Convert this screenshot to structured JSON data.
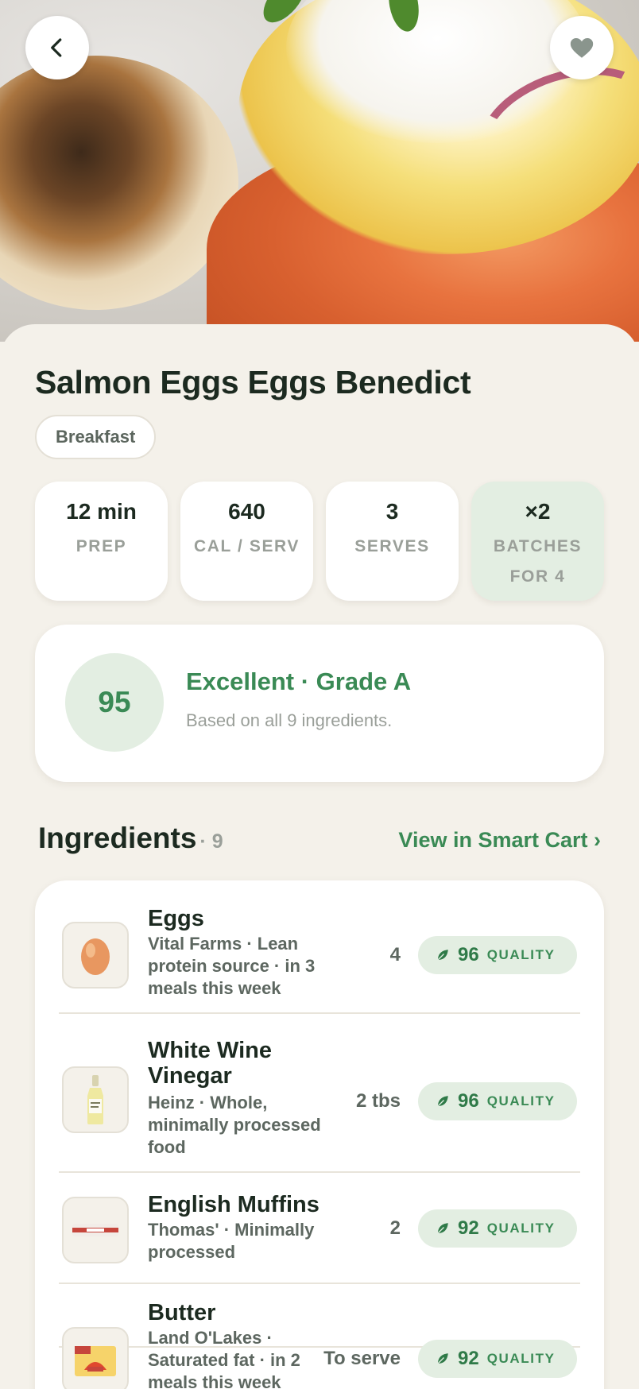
{
  "header": {
    "back_icon": "chevron-left-icon",
    "favorite_icon": "heart-icon"
  },
  "recipe": {
    "title": "Salmon Eggs Eggs Benedict",
    "tag": "Breakfast"
  },
  "stats": [
    {
      "value": "12 min",
      "label": "PREP"
    },
    {
      "value": "640",
      "label": "CAL / SERV"
    },
    {
      "value": "3",
      "label": "SERVES"
    },
    {
      "value": "×2",
      "label": "BATCHES",
      "label2": "FOR 4"
    }
  ],
  "score": {
    "value": "95",
    "title": "Excellent · Grade A",
    "subtitle": "Based on all 9 ingredients."
  },
  "ingredients_section": {
    "title": "Ingredients",
    "count": "· 9",
    "link": "View in Smart Cart ›"
  },
  "ingredients": [
    {
      "name": "Eggs",
      "desc": "Vital Farms · Lean protein source · in 3 meals this week",
      "qty": "4",
      "score": "96",
      "score_label": "QUALITY"
    },
    {
      "name": "White Wine Vinegar",
      "desc": "Heinz · Whole, minimally processed food",
      "qty": "2 tbs",
      "score": "96",
      "score_label": "QUALITY"
    },
    {
      "name": "English Muffins",
      "desc": "Thomas' · Minimally processed",
      "qty": "2",
      "score": "92",
      "score_label": "QUALITY"
    },
    {
      "name": "Butter",
      "desc": "Land O'Lakes · Saturated fat · in 2 meals this week",
      "qty": "To serve",
      "score": "92",
      "score_label": "QUALITY"
    }
  ],
  "colors": {
    "accent": "#3a8a55",
    "accent_bg": "#e3eee2",
    "background": "#f4f1ea"
  }
}
